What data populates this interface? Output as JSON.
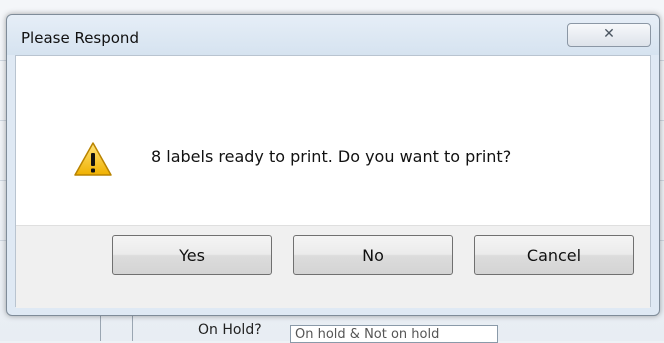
{
  "dialog": {
    "title": "Please Respond",
    "close_glyph": "✕",
    "message": "8 labels ready to print. Do you want to print?",
    "icon": "warning-icon",
    "buttons": {
      "yes": "Yes",
      "no": "No",
      "cancel": "Cancel"
    }
  },
  "background_app": {
    "on_hold_label": "On Hold?",
    "on_hold_value": "On hold & Not on hold"
  }
}
